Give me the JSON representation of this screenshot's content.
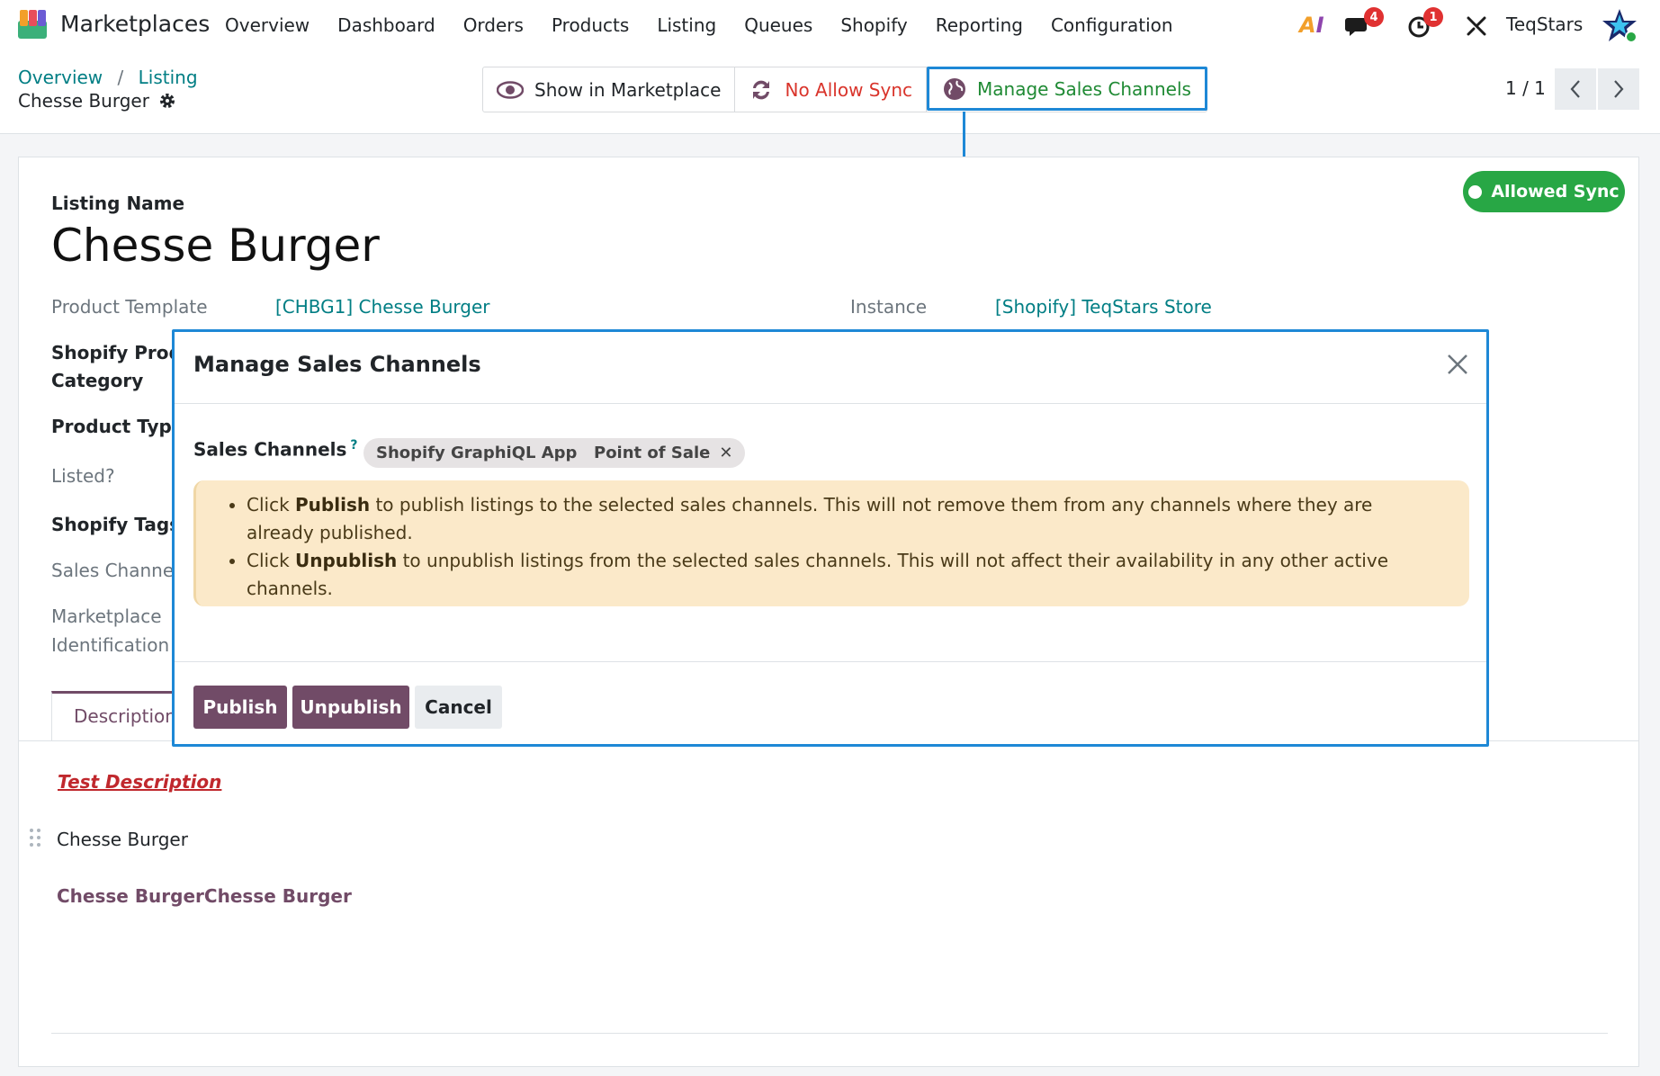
{
  "navbar": {
    "app_name": "Marketplaces",
    "menu": [
      "Overview",
      "Dashboard",
      "Orders",
      "Products",
      "Listing",
      "Queues",
      "Shopify",
      "Reporting",
      "Configuration"
    ],
    "ai_label": "AI",
    "messages_badge": "4",
    "activities_badge": "1",
    "company": "TeqStars"
  },
  "breadcrumb": {
    "items": [
      "Overview",
      "Listing"
    ],
    "separator": "/",
    "current": "Chesse Burger"
  },
  "actions": {
    "show_marketplace": "Show in Marketplace",
    "no_allow_sync": "No Allow Sync",
    "manage_channels": "Manage Sales Channels"
  },
  "pager": {
    "value": "1 / 1"
  },
  "form": {
    "status": "Allowed Sync",
    "listing_name_label": "Listing Name",
    "listing_name": "Chesse Burger",
    "product_template_label": "Product Template",
    "product_template": "[CHBG1] Chesse Burger",
    "instance_label": "Instance",
    "instance": "[Shopify] TeqStars Store",
    "category_label_1": "Shopify Produ",
    "category_label_2": "Category",
    "product_type_label": "Product Type",
    "listed_label": "Listed?",
    "tags_label": "Shopify Tags",
    "sales_channels_label": "Sales Channel",
    "marketplace_id_label_1": "Marketplace",
    "marketplace_id_label_2": "Identification",
    "tab_description": "Description",
    "desc_test": "Test Description",
    "desc_line": "Chesse Burger",
    "desc_bold": "Chesse BurgerChesse Burger"
  },
  "modal": {
    "title": "Manage Sales Channels",
    "field_label": "Sales Channels",
    "help": "?",
    "tags": [
      "Shopify GraphiQL App",
      "Point of Sale"
    ],
    "info_1_pre": "Click ",
    "info_1_bold": "Publish",
    "info_1_post": " to publish listings to the selected sales channels. This will not remove them from any channels where they are already published.",
    "info_2_pre": "Click ",
    "info_2_bold": "Unpublish",
    "info_2_post": " to unpublish listings from the selected sales channels. This will not affect their availability in any other active channels.",
    "publish": "Publish",
    "unpublish": "Unpublish",
    "cancel": "Cancel"
  },
  "colors": {
    "brand": "#714b67",
    "link": "#017e84",
    "highlight": "#1e88d6",
    "success": "#28a745",
    "danger": "#d9342b",
    "alert_bg": "#fbe9c9"
  }
}
